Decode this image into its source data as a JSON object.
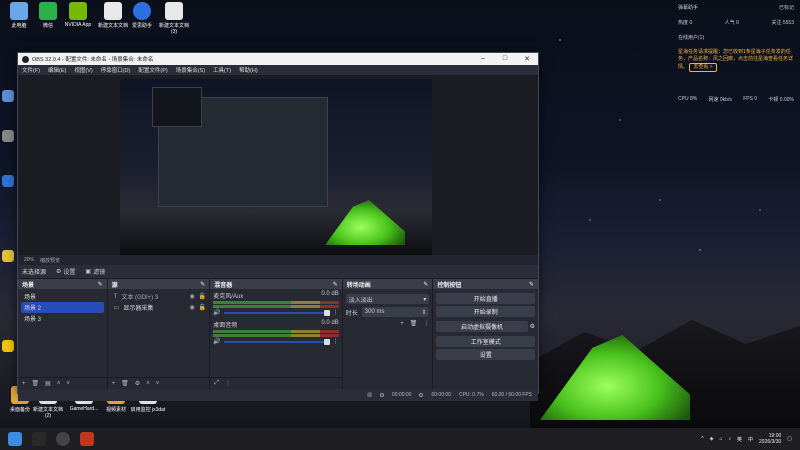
{
  "desktop": {
    "icons": [
      {
        "label": "此电脑",
        "color": "#6aa7e8"
      },
      {
        "label": "微信",
        "color": "#2ab14b"
      },
      {
        "label": "NVIDIA App",
        "color": "#76b900"
      },
      {
        "label": "新建文本文档",
        "color": "#e8e8e8"
      },
      {
        "label": "爱思助手",
        "color": "#2b6fe0"
      },
      {
        "label": "新建文本文档 (3)",
        "color": "#e8e8e8"
      }
    ],
    "bottom_icons": [
      {
        "label": "桌面备份",
        "color": "#e0a93a"
      },
      {
        "label": "新建文本文档 (2)",
        "color": "#e8e8e8"
      },
      {
        "label": "GameHard...",
        "color": "#e8e8e8"
      },
      {
        "label": "视频素材",
        "color": "#e0a93a"
      },
      {
        "label": "启用监控 jx3dat",
        "color": "#e8e8e8"
      }
    ]
  },
  "widget": {
    "title": "弹幕助手",
    "menu": "已标记",
    "stats": [
      {
        "label": "热度 0",
        "value": "人气 0",
        "extra": "关注 5553"
      },
      {
        "label": "在线用户(1)",
        "value": "",
        "extra": ""
      }
    ],
    "notice": "星海任务请求提醒：您已收到1条星海子任务发的任务，产品名称：风之回廊，点击前往星海查看任务详情。",
    "notice_button": "去查看 >",
    "stats_row": [
      "CPU 8%",
      "网速 0kb/s",
      "FPS 0",
      "卡顿 0.00%"
    ]
  },
  "obs": {
    "title": "OBS 32.0.4 - 配置文件: 未命名 - 场景集合: 未命名",
    "menu": [
      "文件(F)",
      "编辑(E)",
      "视图(V)",
      "停靠窗口(D)",
      "配置文件(P)",
      "场景集合(S)",
      "工具(T)",
      "帮助(H)"
    ],
    "zoom": "20%",
    "zoom_label": "缩放预览",
    "scene_bar": {
      "no_source": "未选择源",
      "properties": "设置",
      "filters": "滤镜"
    },
    "docks": {
      "scenes": {
        "title": "场景",
        "items": [
          "场景",
          "场景 2",
          "场景 3"
        ],
        "selected": 1
      },
      "sources": {
        "title": "源",
        "items": [
          {
            "label": "文本 (GDI+) 3",
            "icon": "text-icon"
          },
          {
            "label": "显示器采集",
            "icon": "monitor-icon"
          }
        ]
      },
      "mixer": {
        "title": "混音器",
        "channels": [
          {
            "name": "麦克风/Aux",
            "db": "0.0 dB"
          },
          {
            "name": "桌面音频",
            "db": "0.0 dB"
          }
        ]
      },
      "transitions": {
        "title": "转场动画",
        "type": "淡入淡出",
        "duration_label": "时长",
        "duration": "300 ms"
      },
      "controls": {
        "title": "控制按钮",
        "buttons": [
          "开始直播",
          "开始录制",
          "启动虚拟摄像机",
          "工作室模式",
          "设置"
        ]
      }
    },
    "status": {
      "rec": "00:00:00",
      "stream": "00:00:00",
      "cpu": "CPU: 0.7%",
      "fps": "60.00 / 60.00 FPS"
    }
  },
  "taskbar": {
    "time": "19:00",
    "date": "2026/3/30",
    "tray": [
      "^",
      "英",
      "中"
    ]
  }
}
